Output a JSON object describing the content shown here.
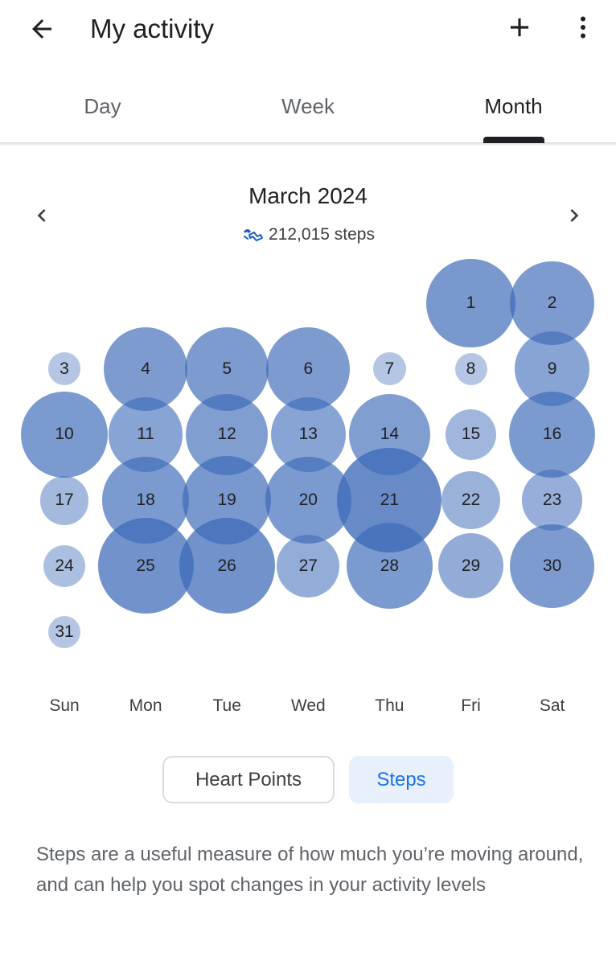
{
  "appbar": {
    "title": "My activity",
    "back_icon": "arrow-back-icon",
    "add_icon": "plus-icon",
    "more_icon": "more-vert-icon"
  },
  "tabs": [
    {
      "label": "Day",
      "active": false
    },
    {
      "label": "Week",
      "active": false
    },
    {
      "label": "Month",
      "active": true
    }
  ],
  "month_nav": {
    "title": "March 2024",
    "total_steps": "212,015 steps",
    "prev_icon": "chevron-left-icon",
    "next_icon": "chevron-right-icon",
    "steps_icon": "steps-icon"
  },
  "weekdays": [
    "Sun",
    "Mon",
    "Tue",
    "Wed",
    "Thu",
    "Fri",
    "Sat"
  ],
  "calendar": {
    "month_start_weekday": 5,
    "days_in_month": 31,
    "bubble_color": "#3d6ab8",
    "relative_step_level": [
      0.38,
      0.36,
      0.14,
      0.36,
      0.36,
      0.36,
      0.14,
      0.13,
      0.32,
      0.37,
      0.32,
      0.35,
      0.32,
      0.35,
      0.22,
      0.37,
      0.21,
      0.37,
      0.38,
      0.37,
      0.45,
      0.25,
      0.26,
      0.18,
      0.41,
      0.41,
      0.27,
      0.37,
      0.28,
      0.36,
      0.13
    ]
  },
  "metric_toggle": {
    "heart_points_label": "Heart Points",
    "steps_label": "Steps",
    "selected": "Steps"
  },
  "description": "Steps are a useful measure of how much you’re moving around, and can help you spot changes in your activity levels",
  "colors": {
    "accent": "#1a73e8",
    "chip_selected_bg": "#e8f0fe",
    "bubble": "#3d6ab8"
  }
}
